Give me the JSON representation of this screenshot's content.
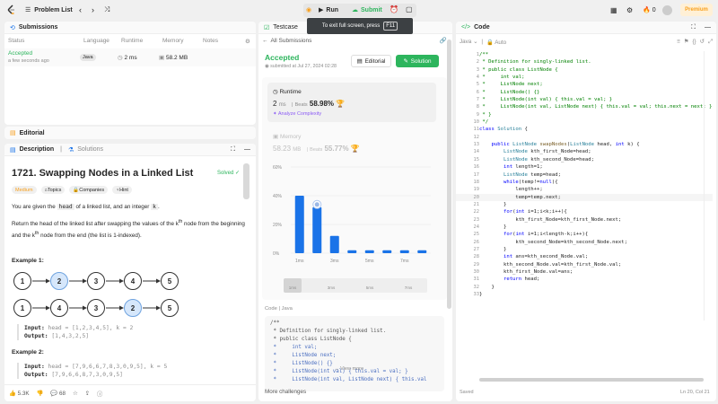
{
  "topbar": {
    "problem_list": "Problem List",
    "run": "Run",
    "submit": "Submit",
    "tooltip_text": "To exit full screen, press",
    "tooltip_key": "F11",
    "fire_count": "0",
    "premium": "Premium"
  },
  "submissions": {
    "title": "Submissions",
    "columns": [
      "Status",
      "Language",
      "Runtime",
      "Memory",
      "Notes"
    ],
    "row": {
      "status": "Accepted",
      "time": "a few seconds ago",
      "language": "Java",
      "runtime": "2 ms",
      "memory": "58.2 MB"
    }
  },
  "editorial": {
    "title": "Editorial"
  },
  "description": {
    "tab_description": "Description",
    "tab_solutions": "Solutions",
    "title": "1721. Swapping Nodes in a Linked List",
    "solved": "Solved",
    "tags": [
      "Medium",
      "Topics",
      "Companies",
      "Hint"
    ],
    "p1a": "You are given the",
    "p1code": "head",
    "p1b": "of a linked list, and an integer",
    "p1k": "k",
    "p2": "Return the head of the linked list after swapping the values of the k",
    "p2b": "node from the beginning and the k",
    "p2c": "node from the end (the list is 1-indexed).",
    "th": "th",
    "example1": "Example 1:",
    "list1": [
      "1",
      "2",
      "3",
      "4",
      "5"
    ],
    "list2": [
      "1",
      "4",
      "3",
      "2",
      "5"
    ],
    "input1_label": "Input:",
    "input1": "head = [1,2,3,4,5], k = 2",
    "output1_label": "Output:",
    "output1": "[1,4,3,2,5]",
    "example2": "Example 2:",
    "input2_label": "Input:",
    "input2": "head = [7,9,6,6,7,8,3,0,9,5], k = 5",
    "output2_label": "Output:",
    "output2": "[7,9,6,6,8,7,3,0,9,5]",
    "likes": "5.3K",
    "comments": "68"
  },
  "result": {
    "tab": "Testcase",
    "back": "All Submissions",
    "status": "Accepted",
    "submitted": "submitted at Jul 27, 2024 02:28",
    "editorial_btn": "Editorial",
    "solution_btn": "Solution",
    "runtime_label": "Runtime",
    "runtime_val": "2",
    "runtime_unit": "ms",
    "beats_label": "Beats",
    "runtime_beats": "58.98%",
    "analyze": "Analyze Complexity",
    "memory_label": "Memory",
    "memory_val": "58.23",
    "memory_unit": "MB",
    "memory_beats": "55.77%",
    "code_label": "Code",
    "code_lang": "Java",
    "view_more": "View more",
    "more_challenges": "More challenges",
    "snippet": [
      "/**",
      " * Definition for singly-linked list.",
      " * public class ListNode {",
      " *     int val;",
      " *     ListNode next;",
      " *     ListNode() {}",
      " *     ListNode(int val) { this.val = val; }",
      " *     ListNode(int val, ListNode next) { this.val"
    ]
  },
  "chart_data": {
    "type": "bar",
    "yticks": [
      "60%",
      "40%",
      "20%",
      "0%"
    ],
    "ylim": [
      0,
      60
    ],
    "xticks": [
      "1ms",
      "3ms",
      "5ms",
      "7ms"
    ],
    "values": [
      40,
      32,
      12,
      2,
      2,
      2,
      2,
      2
    ],
    "highlight_index": 1,
    "bar_color": "#1a73e8",
    "mini_ticks": [
      "1ms",
      "3ms",
      "5ms",
      "7ms"
    ]
  },
  "code": {
    "title": "Code",
    "lang": "Java",
    "auto": "Auto",
    "saved": "Saved",
    "cursor": "Ln 20, Col 21",
    "lines": [
      "/**",
      " * Definition for singly-linked list.",
      " * public class ListNode {",
      " *     int val;",
      " *     ListNode next;",
      " *     ListNode() {}",
      " *     ListNode(int val) { this.val = val; }",
      " *     ListNode(int val, ListNode next) { this.val = val; this.next = next; }",
      " * }",
      " */",
      "class Solution {",
      "",
      "    public ListNode swapNodes(ListNode head, int k) {",
      "        ListNode kth_first_Node=head;",
      "        ListNode kth_second_Node=head;",
      "        int length=1;",
      "        ListNode temp=head;",
      "        while(temp!=null){",
      "            length++;",
      "            temp=temp.next;",
      "        }",
      "        for(int i=1;i<k;i++){",
      "            kth_first_Node=kth_first_Node.next;",
      "        }",
      "        for(int i=1;i<length-k;i++){",
      "            kth_second_Node=kth_second_Node.next;",
      "        }",
      "        int ans=kth_second_Node.val;",
      "        kth_second_Node.val=kth_first_Node.val;",
      "        kth_first_Node.val=ans;",
      "        return head;",
      "    }",
      "}"
    ]
  }
}
